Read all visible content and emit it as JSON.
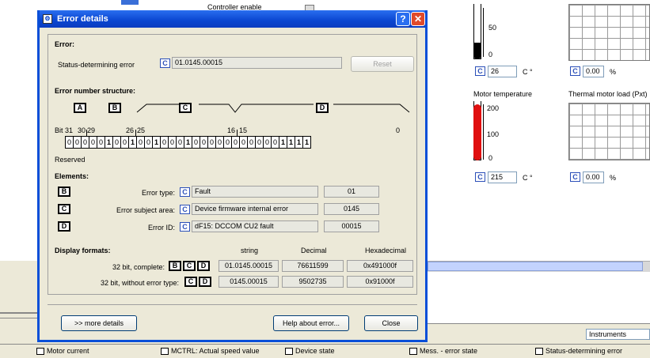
{
  "bg": {
    "controller_enable": "Controller enable",
    "field_26": "26",
    "unit_c1": "C °",
    "field_000_1": "0.00",
    "pct1": "%",
    "motor_temp": "Motor temperature",
    "thermal_load": "Thermal motor load (Pxt)",
    "field_215": "215",
    "unit_c2": "C °",
    "field_000_2": "0.00",
    "pct2": "%",
    "gauge1_labels": [
      "50",
      "0"
    ],
    "gauge2_labels": [
      "200",
      "100",
      "0"
    ],
    "instruments": "Instruments"
  },
  "dialog": {
    "title": "Error details",
    "error_header": "Error:",
    "status_label": "Status-determining error",
    "status_value": "01.0145.00015",
    "reset": "Reset",
    "structure_header": "Error number structure:",
    "bit_labels": [
      "Bit 31",
      "30",
      "29",
      "26",
      "25",
      "16",
      "15",
      "0"
    ],
    "bits": [
      "0",
      "0",
      "0",
      "0",
      "0",
      "1",
      "0",
      "0",
      "1",
      "0",
      "0",
      "1",
      "0",
      "0",
      "0",
      "1",
      "0",
      "0",
      "0",
      "0",
      "0",
      "0",
      "0",
      "0",
      "0",
      "0",
      "0",
      "1",
      "1",
      "1",
      "1"
    ],
    "reserved": "Reserved",
    "elements_header": "Elements:",
    "elements": [
      {
        "tag": "B",
        "label": "Error type:",
        "text": "Fault",
        "value": "01"
      },
      {
        "tag": "C",
        "label": "Error subject area:",
        "text": "Device firmware internal error",
        "value": "0145"
      },
      {
        "tag": "D",
        "label": "Error ID:",
        "text": "dF15: DCCOM CU2 fault",
        "value": "00015"
      }
    ],
    "formats_header": "Display formats:",
    "col_string": "string",
    "col_decimal": "Decimal",
    "col_hex": "Hexadecimal",
    "row1_label": "32 bit, complete:",
    "row1_string": "01.0145.00015",
    "row1_dec": "76611599",
    "row1_hex": "0x491000f",
    "row2_label": "32 bit, without error type:",
    "row2_string": "0145.00015",
    "row2_dec": "9502735",
    "row2_hex": "0x91000f",
    "more": ">> more details",
    "help": "Help about error...",
    "close": "Close"
  },
  "statusbar": [
    "Motor current",
    "MCTRL: Actual speed value",
    "Device state",
    "Mess. - error state",
    "Status-determining error"
  ]
}
